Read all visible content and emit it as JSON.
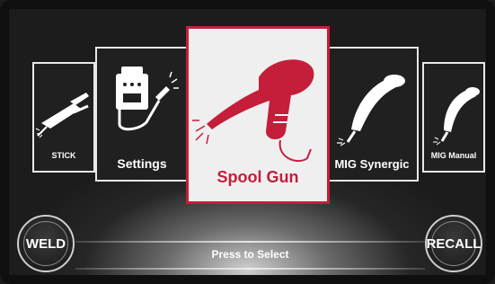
{
  "carousel": {
    "items": [
      {
        "label": "STICK",
        "icon": "stick-electrode-icon"
      },
      {
        "label": "Settings",
        "icon": "settings-machine-icon"
      },
      {
        "label": "Spool Gun",
        "icon": "spool-gun-icon",
        "selected": true
      },
      {
        "label": "MIG Synergic",
        "icon": "mig-torch-icon"
      },
      {
        "label": "MIG Manual",
        "icon": "mig-torch-icon"
      }
    ]
  },
  "buttons": {
    "weld_label": "WELD",
    "recall_label": "RECALL"
  },
  "footer": {
    "hint": "Press to Select"
  },
  "colors": {
    "accent": "#c41e3a",
    "card_border": "#e8e8e8",
    "background": "#1c1c1c"
  }
}
